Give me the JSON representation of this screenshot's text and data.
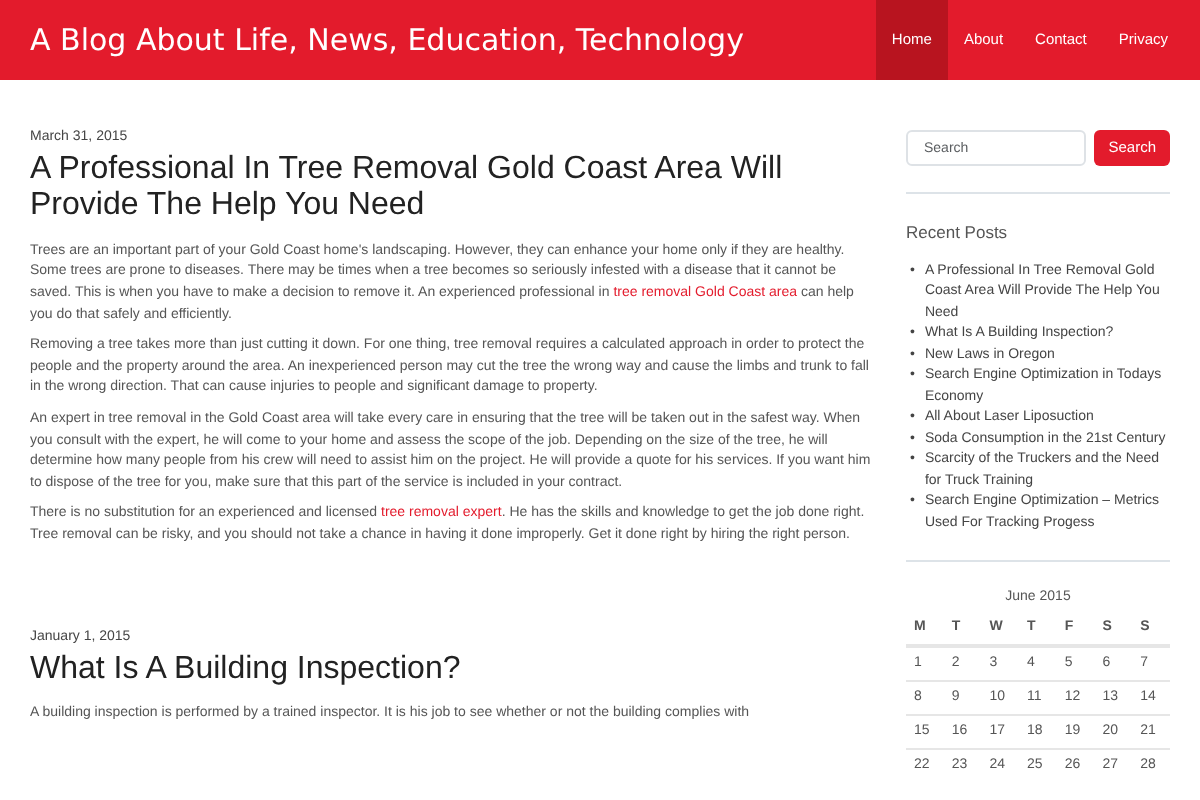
{
  "site_title": "A Blog About Life, News, Education, Technology",
  "nav": [
    {
      "label": "Home",
      "selected": true
    },
    {
      "label": "About",
      "selected": false
    },
    {
      "label": "Contact",
      "selected": false
    },
    {
      "label": "Privacy",
      "selected": false
    }
  ],
  "posts": [
    {
      "date": "March 31, 2015",
      "title": "A Professional In Tree Removal Gold Coast Area Will Provide The Help You Need",
      "paragraphs": [
        [
          {
            "text": "Trees are an important part of your Gold Coast home's landscaping. However, they can enhance your home only if they are healthy. Some trees are prone to diseases. There may be times when a tree becomes so seriously infested with a disease that it cannot be saved. This is when you have to make a decision to remove it. An experienced professional in ",
            "link": false
          },
          {
            "text": "tree removal Gold Coast area",
            "link": true
          },
          {
            "text": " can help you do that safely and efficiently.",
            "link": false
          }
        ],
        [
          {
            "text": "Removing a tree takes more than just cutting it down. For one thing, tree removal requires a calculated approach in order to protect the people and the property around the area. An inexperienced person may cut the tree the wrong way and cause the limbs and trunk to fall in the wrong direction. That can cause injuries to people and significant damage to property.",
            "link": false
          }
        ],
        [
          {
            "text": "An expert in tree removal in the Gold Coast area will take every care in ensuring that the tree will be taken out in the safest way. When you consult with the expert, he will come to your home and assess the scope of the job. Depending on the size of the tree, he will determine how many people from his crew will need to assist him on the project. He will provide a quote for his services. If you want him to dispose of the tree for you, make sure that this part of the service is included in your contract.",
            "link": false
          }
        ],
        [
          {
            "text": "There is no substitution for an experienced and licensed ",
            "link": false
          },
          {
            "text": "tree removal expert",
            "link": true
          },
          {
            "text": ". He has the skills and knowledge to get the job done right. Tree removal can be risky, and you should not take a chance in having it done improperly. Get it done right by hiring the right person.",
            "link": false
          }
        ]
      ]
    },
    {
      "date": "January 1, 2015",
      "title": "What Is A Building Inspection?",
      "paragraphs": [
        [
          {
            "text": "A building inspection is performed by a trained inspector.  It is his job to see whether or not the building complies with",
            "link": false
          }
        ]
      ]
    }
  ],
  "search": {
    "placeholder": "Search",
    "button": "Search"
  },
  "recent_posts": {
    "title": "Recent Posts",
    "bullet": "•",
    "items": [
      "A Professional In Tree Removal Gold Coast Area Will Provide The Help You Need",
      "What Is A Building Inspection?",
      "New Laws in Oregon",
      "Search Engine Optimization in Todays Economy",
      "All About Laser Liposuction",
      "Soda Consumption in the 21st Century",
      "Scarcity of the Truckers and the Need for Truck Training",
      "Search Engine Optimization – Metrics Used For Tracking Progess"
    ]
  },
  "calendar": {
    "caption": "June 2015",
    "weekdays": [
      "M",
      "T",
      "W",
      "T",
      "F",
      "S",
      "S"
    ],
    "weeks": [
      [
        "1",
        "2",
        "3",
        "4",
        "5",
        "6",
        "7"
      ],
      [
        "8",
        "9",
        "10",
        "11",
        "12",
        "13",
        "14"
      ],
      [
        "15",
        "16",
        "17",
        "18",
        "19",
        "20",
        "21"
      ],
      [
        "22",
        "23",
        "24",
        "25",
        "26",
        "27",
        "28"
      ]
    ]
  }
}
